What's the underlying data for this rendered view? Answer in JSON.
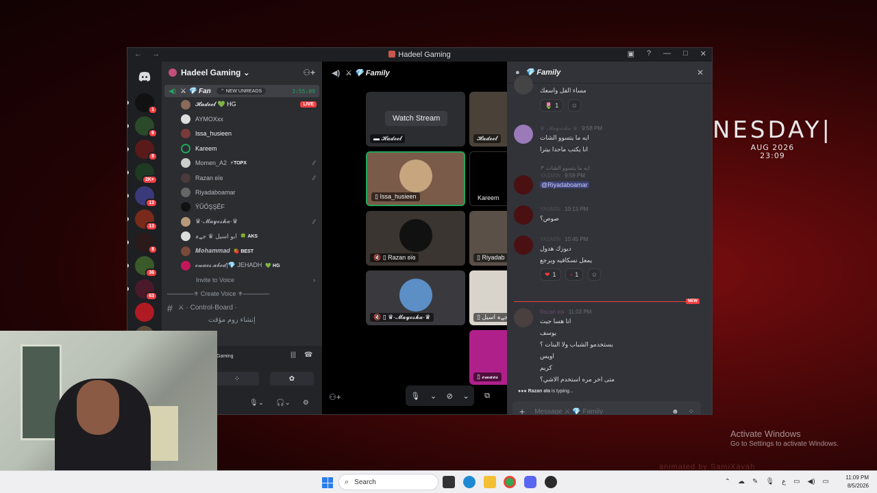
{
  "desktop": {
    "day": "NESDAY|",
    "date": "AUG 2026",
    "time": "23:09",
    "activate_title": "Activate Windows",
    "activate_sub": "Go to Settings to activate Windows.",
    "watermark": "animated by SamiXavah"
  },
  "window": {
    "title": "Hadeel Gaming",
    "nav": "← →"
  },
  "servers": {
    "badges": [
      "1",
      "6",
      "8",
      "2K+",
      "13",
      "13",
      "8",
      "36",
      "63",
      "",
      "4"
    ]
  },
  "sidebar": {
    "guild_name": "Hadeel Gaming ⌄",
    "voice_channel": {
      "name": "⚔ 💎 Fan",
      "unreads": "⌃ NEW UNREADS",
      "timer": "3:55:09"
    },
    "users": [
      {
        "name": "𝓗𝓪𝓭𝓮𝓮𝓵 💚 HG",
        "live": "LIVE"
      },
      {
        "name": "AYMOXxx"
      },
      {
        "name": "Issa_husieen"
      },
      {
        "name": "Kareem"
      },
      {
        "name": "Momen_A2",
        "tag": "⚡TOPX"
      },
      {
        "name": "Razan ʚïɞ"
      },
      {
        "name": "Riyadaboamar"
      },
      {
        "name": "ŸŬŐŞŞĚF"
      },
      {
        "name": "♛·𝓜𝓪𝔂𝓸𝓼𝓱𝓪·♛"
      },
      {
        "name": "ابو اسيل ♛ جےہ",
        "tag": "🍀 AKS"
      },
      {
        "name": "𝑴𝒐𝒉𝒂𝒎𝒎𝒂𝒅",
        "tag": "🍓 BEST"
      },
      {
        "name": "𝓸𝔀𝓪𝓮𝓼.𝓪𝓫𝓮𝓭|💎 JEHADH",
        "tag": "💚 HG"
      }
    ],
    "invite_voice": "Invite to Voice",
    "category": "──────⚜ Create Voice ⚜──────",
    "channel": "⚔ · Control-Board ·",
    "channel2": "إنشاء روم مؤقت"
  },
  "user_panel": {
    "status": "Gaming"
  },
  "stage": {
    "title": "⚔ 💎 Family",
    "watch_stream": "Watch Stream",
    "tiles": [
      {
        "label": "▬ 𝓗𝓪𝓭𝓮𝓮𝓵"
      },
      {
        "label": "𝓗𝓪𝓭𝓮𝓮𝓵"
      },
      {
        "label": "▯ Issa_husieen"
      },
      {
        "label": "Kareem"
      },
      {
        "label": "🔇 ▯ Razan ʚïɞ"
      },
      {
        "label": "▯ Riyadab"
      },
      {
        "label": "🔇 ▯ ♛·𝓜𝓪𝔂𝓸𝓼𝓱𝓪·♛"
      },
      {
        "label": "▯ جےہ اسيل"
      },
      {
        "label": "▯ 𝓸𝔀𝓪𝓮𝓼"
      }
    ]
  },
  "chat": {
    "title": "💎 Family",
    "messages": [
      {
        "lines": [
          "مساء الفل واسعك"
        ],
        "reactions": [
          {
            "emoji": "🌷",
            "count": "1"
          }
        ]
      },
      {
        "author": "♛·𝓜𝓪𝔂𝓸𝓼𝓱𝓪·♛",
        "time": "9:58 PM",
        "lines": [
          "ايه ما يتسوو الشات",
          "انا يكتب ماحدا بيترا"
        ]
      },
      {
        "reply": "ايه ما يتسوو الشات",
        "author": "YASMIN",
        "time": "9:59 PM",
        "lines": [
          "@Riyadaboamar"
        ]
      },
      {
        "author": "YASMIN",
        "time": "10:13 PM",
        "lines": [
          "صوص؟"
        ]
      },
      {
        "author": "YASMIN",
        "time": "10:45 PM",
        "lines": [
          "ديوزك هدول",
          "يمعل نسكافيه ويرجع"
        ],
        "reactions": [
          {
            "emoji": "❤",
            "count": "1"
          },
          {
            "emoji": "▪",
            "count": "1"
          }
        ]
      },
      {
        "author": "Razan ʚïɞ",
        "time": "11:03 PM",
        "lines": [
          "انا هسا جيت",
          "يوسف",
          "بستخدمو الشباب ولا البنات ؟",
          "اويس",
          "كريم",
          "متى اخر مره استخدم الاشي؟"
        ]
      }
    ],
    "new_label": "NEW",
    "typing_user": "Razan ʚïɞ",
    "typing_suffix": " is typing...",
    "composer_placeholder": "Message ⚔ 💎 Family"
  },
  "taskbar": {
    "search": "Search",
    "time": "11:09 PM",
    "date": "8/5/2026",
    "lang": "ع"
  }
}
